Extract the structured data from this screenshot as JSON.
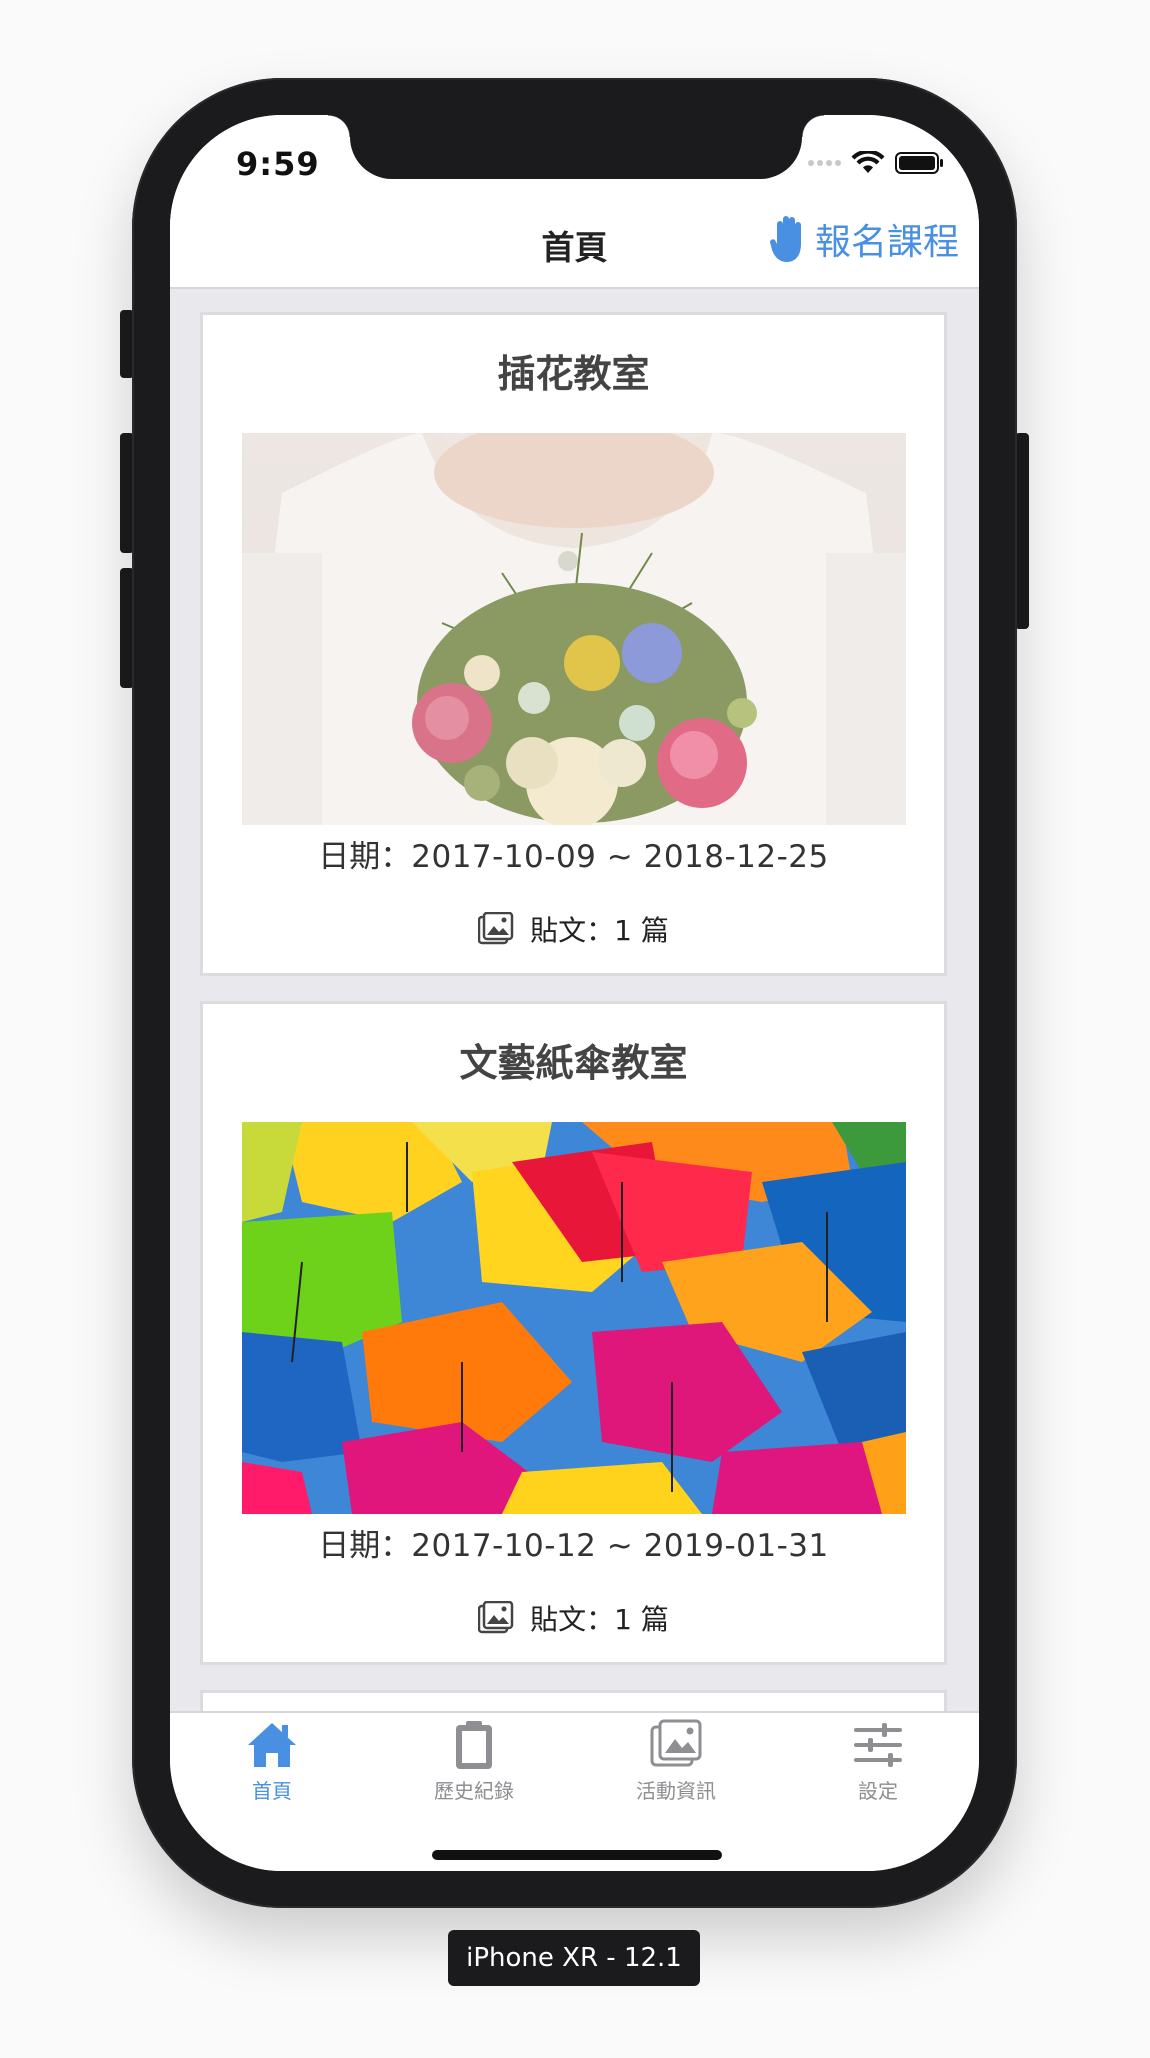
{
  "status_bar": {
    "time": "9:59"
  },
  "nav": {
    "title": "首頁",
    "action_label": "報名課程",
    "action_icon": "hand-icon",
    "accent_color": "#4a90e2"
  },
  "cards": [
    {
      "title": "插花教室",
      "image": "flower-bouquet-photo",
      "date_label": "日期：",
      "date_value": "2017-10-09 ~ 2018-12-25",
      "posts_label": "貼文：",
      "posts_value": "1 篇"
    },
    {
      "title": "文藝紙傘教室",
      "image": "colorful-umbrellas-photo",
      "date_label": "日期：",
      "date_value": "2017-10-12 ~ 2019-01-31",
      "posts_label": "貼文：",
      "posts_value": "1 篇"
    }
  ],
  "tabbar": {
    "items": [
      {
        "label": "首頁",
        "icon": "home-icon",
        "active": true
      },
      {
        "label": "歷史紀錄",
        "icon": "clipboard-icon",
        "active": false
      },
      {
        "label": "活動資訊",
        "icon": "photos-icon",
        "active": false
      },
      {
        "label": "設定",
        "icon": "sliders-icon",
        "active": false
      }
    ]
  },
  "device_label": "iPhone XR - 12.1"
}
